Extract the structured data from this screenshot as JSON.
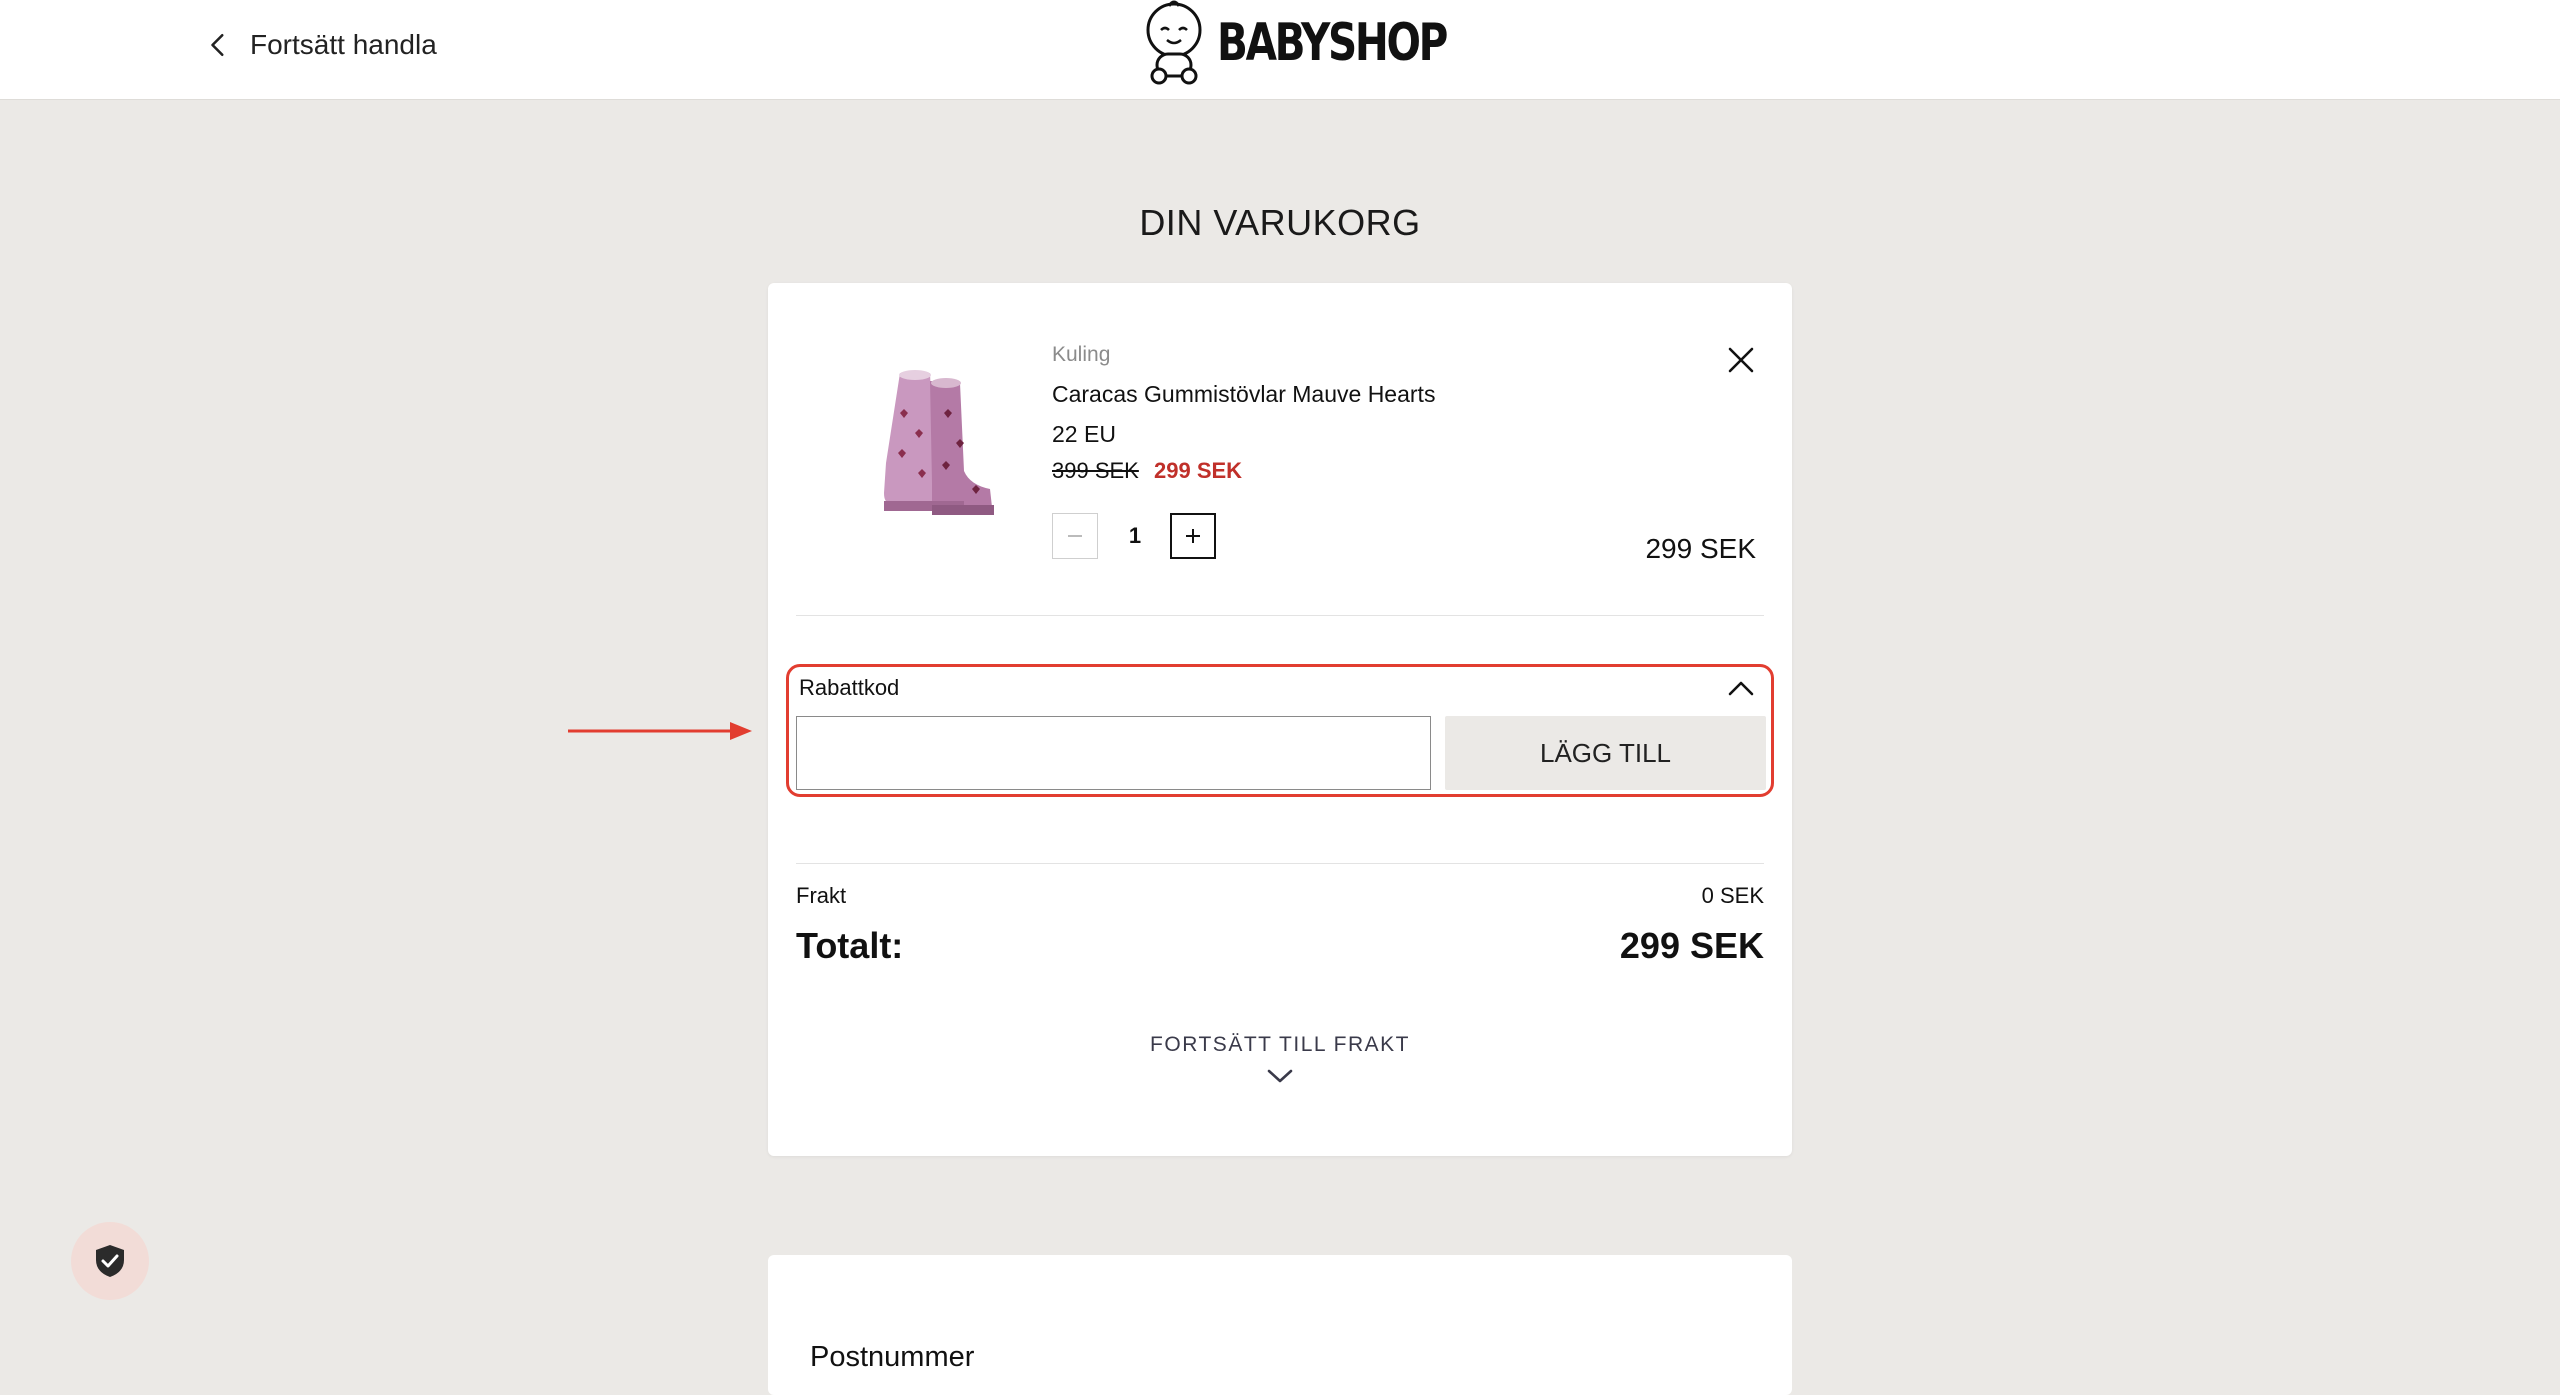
{
  "header": {
    "back_label": "Fortsätt handla",
    "logo_text": "BABYSHOP"
  },
  "page_title": "DIN VARUKORG",
  "cart": {
    "item": {
      "brand": "Kuling",
      "name": "Caracas Gummistövlar Mauve Hearts",
      "size": "22 EU",
      "original_price": "399 SEK",
      "sale_price": "299 SEK",
      "quantity": "1",
      "line_total": "299 SEK"
    },
    "discount": {
      "label": "Rabattkod",
      "input_value": "",
      "input_placeholder": "",
      "apply_label": "LÄGG TILL"
    },
    "shipping_label": "Frakt",
    "shipping_value": "0 SEK",
    "total_label": "Totalt:",
    "total_value": "299 SEK",
    "continue_label": "FORTSÄTT TILL FRAKT"
  },
  "postal_section": {
    "title": "Postnummer"
  },
  "colors": {
    "page_background": "#ebe9e6",
    "sale_red": "#c0302a",
    "highlight_red": "#e23d30",
    "badge_background": "#f2dcd7"
  },
  "icons": {
    "back": "chevron-left-icon",
    "remove": "close-icon",
    "discount_toggle": "chevron-up-icon",
    "continue": "chevron-down-icon",
    "trust": "shield-check-icon"
  }
}
